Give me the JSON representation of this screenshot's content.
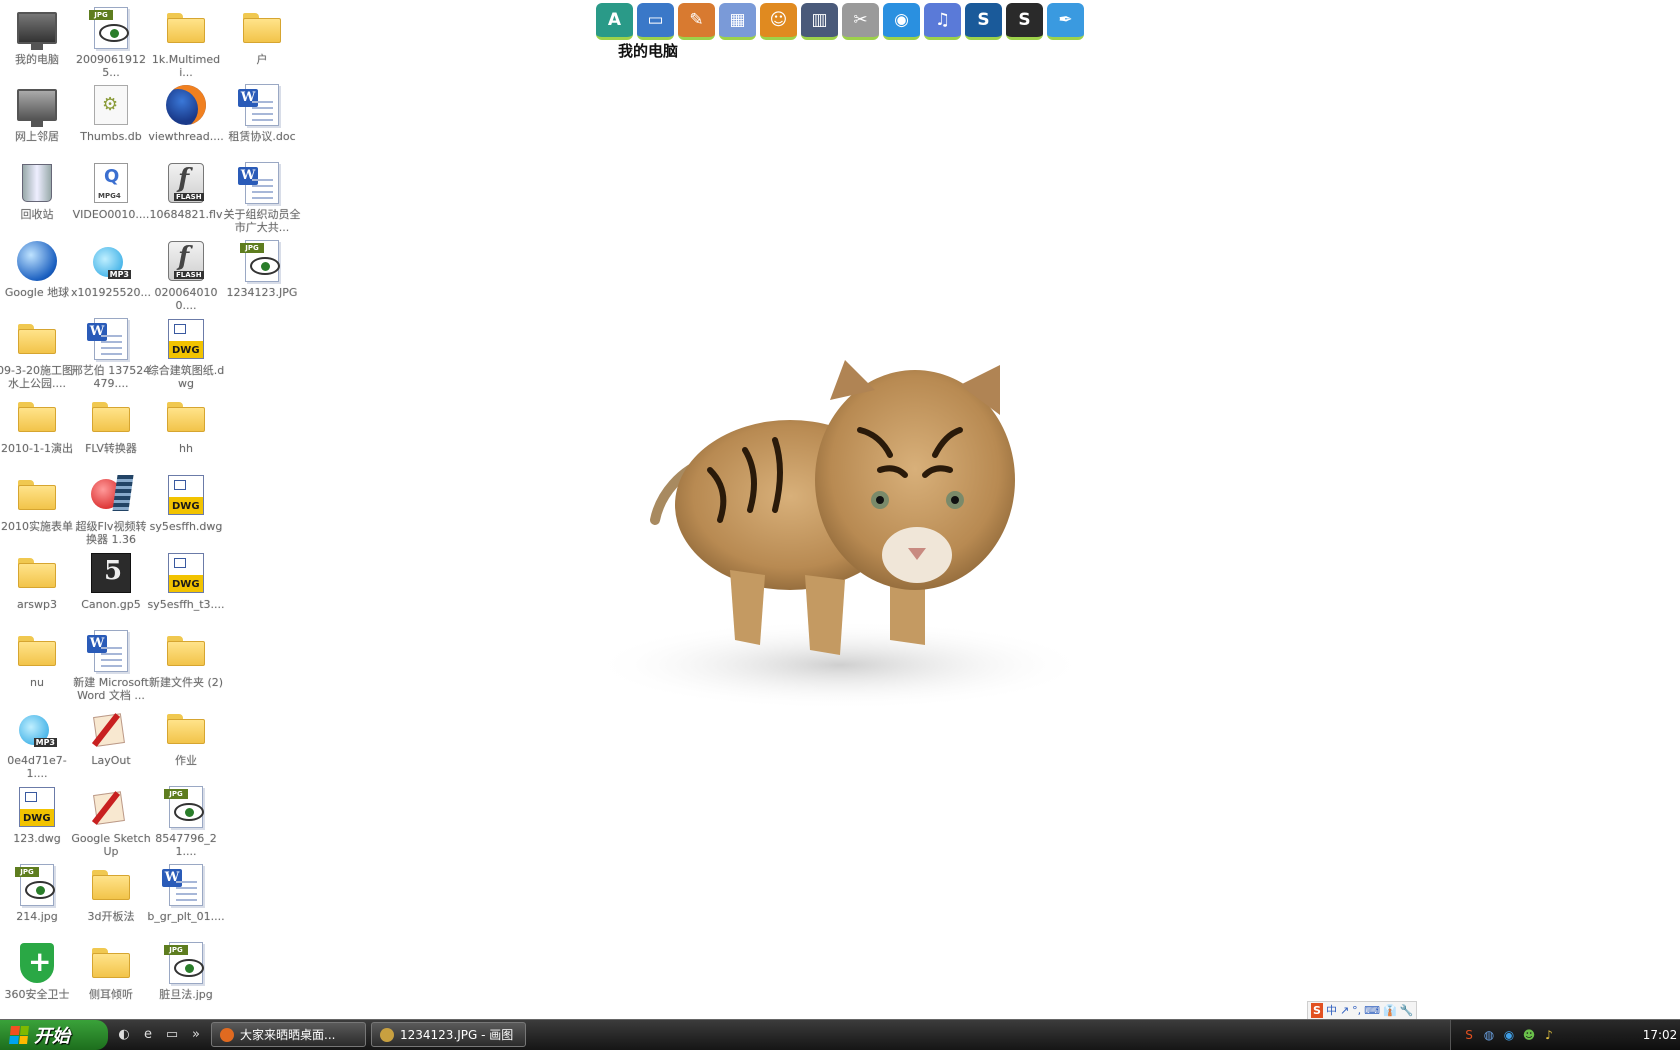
{
  "desktop_icons": [
    {
      "label": "我的电脑",
      "icon": "computer-icon"
    },
    {
      "label": "20090619125...",
      "icon": "jpg-image-icon"
    },
    {
      "label": "1k.Multimedi...",
      "icon": "folder-icon"
    },
    {
      "label": "户",
      "icon": "folder-icon"
    },
    {
      "label": "网上邻居",
      "icon": "network-icon"
    },
    {
      "label": "Thumbs.db",
      "icon": "db-file-icon"
    },
    {
      "label": "viewthread....",
      "icon": "firefox-html-icon"
    },
    {
      "label": "租赁协议.doc",
      "icon": "word-doc-icon"
    },
    {
      "label": "回收站",
      "icon": "recycle-bin-icon"
    },
    {
      "label": "VIDEO0010....",
      "icon": "mpg4-video-icon"
    },
    {
      "label": "10684821.flv",
      "icon": "flash-video-icon"
    },
    {
      "label": "关于组织动员全市广大共...",
      "icon": "word-doc-icon"
    },
    {
      "label": "Google 地球",
      "icon": "google-earth-icon"
    },
    {
      "label": "x101925520...",
      "icon": "mp3-audio-icon"
    },
    {
      "label": "0200640100....",
      "icon": "flash-video-icon"
    },
    {
      "label": "1234123.JPG",
      "icon": "jpg-image-icon"
    },
    {
      "label": "09-3-20施工图-水上公园....",
      "icon": "folder-icon"
    },
    {
      "label": "邢艺伯 137524479....",
      "icon": "word-doc-icon"
    },
    {
      "label": "综合建筑图纸.dwg",
      "icon": "dwg-file-icon"
    },
    {
      "label": "2010-1-1演出",
      "icon": "folder-icon"
    },
    {
      "label": "FLV转换器",
      "icon": "folder-icon"
    },
    {
      "label": "hh",
      "icon": "folder-icon"
    },
    {
      "label": "2010实施表单",
      "icon": "folder-icon"
    },
    {
      "label": "超级Flv视频转换器 1.36",
      "icon": "video-converter-icon"
    },
    {
      "label": "sy5esffh.dwg",
      "icon": "dwg-file-icon"
    },
    {
      "label": "arswp3",
      "icon": "folder-icon"
    },
    {
      "label": "Canon.gp5",
      "icon": "guitar-pro-icon"
    },
    {
      "label": "sy5esffh_t3....",
      "icon": "dwg-file-icon"
    },
    {
      "label": "nu",
      "icon": "folder-icon"
    },
    {
      "label": "新建 Microsoft Word 文档 ...",
      "icon": "word-doc-icon"
    },
    {
      "label": "新建文件夹 (2)",
      "icon": "folder-icon"
    },
    {
      "label": "0e4d71e7-1....",
      "icon": "mp3-audio-icon"
    },
    {
      "label": "LayOut",
      "icon": "layout-app-icon"
    },
    {
      "label": "作业",
      "icon": "folder-icon"
    },
    {
      "label": "123.dwg",
      "icon": "dwg-file-icon"
    },
    {
      "label": "Google SketchUp",
      "icon": "sketchup-icon"
    },
    {
      "label": "8547796_21....",
      "icon": "jpg-image-icon"
    },
    {
      "label": "214.jpg",
      "icon": "jpg-image-icon"
    },
    {
      "label": "3d开板法",
      "icon": "folder-icon"
    },
    {
      "label": "b_gr_plt_01....",
      "icon": "word-doc-icon"
    },
    {
      "label": "360安全卫士",
      "icon": "security-shield-icon"
    },
    {
      "label": "侧耳倾听",
      "icon": "folder-icon"
    },
    {
      "label": "脏旦法.jpg",
      "icon": "jpg-image-icon"
    }
  ],
  "quick_launch": {
    "label": "我的电脑",
    "icons": [
      {
        "name": "autocad-a-icon",
        "glyph": "A",
        "color": "#2a9a88"
      },
      {
        "name": "my-computer-icon",
        "glyph": "▭",
        "color": "#3a78c8"
      },
      {
        "name": "paint-icon",
        "glyph": "✎",
        "color": "#d87a30"
      },
      {
        "name": "calculator-icon",
        "glyph": "▦",
        "color": "#7a9ad8"
      },
      {
        "name": "qq-game-icon",
        "glyph": "☺",
        "color": "#e08a20"
      },
      {
        "name": "books-icon",
        "glyph": "▥",
        "color": "#4a5a7a"
      },
      {
        "name": "tools-icon",
        "glyph": "✂",
        "color": "#9a9a9a"
      },
      {
        "name": "qq-penguin-icon",
        "glyph": "◉",
        "color": "#2a90e0"
      },
      {
        "name": "media-player-icon",
        "glyph": "♫",
        "color": "#5a7ad8"
      },
      {
        "name": "3dsmax-icon",
        "glyph": "S",
        "color": "#1a5a9a"
      },
      {
        "name": "3dsmax-old-icon",
        "glyph": "S",
        "color": "#2a2a2a"
      },
      {
        "name": "feather-pen-icon",
        "glyph": "✒",
        "color": "#3a9ae0"
      }
    ]
  },
  "ime_toolbar": [
    "S",
    "中",
    "↗",
    "°,",
    "⌨",
    "👔",
    "🔧"
  ],
  "taskbar": {
    "start_label": "开始",
    "quick_icons": [
      "firefox-icon",
      "ie-icon",
      "show-desktop-icon",
      "more-chevron-icon"
    ],
    "tasks": [
      {
        "label": "大家来晒晒桌面...",
        "icon_color": "#e06a20"
      },
      {
        "label": "1234123.JPG - 画图",
        "icon_color": "#c8a040"
      }
    ],
    "tray_icons": [
      "sogou-tray-icon",
      "network-tray-icon",
      "qq-tray-icon",
      "msn-tray-icon",
      "volume-tray-icon"
    ],
    "clock": "17:02"
  }
}
